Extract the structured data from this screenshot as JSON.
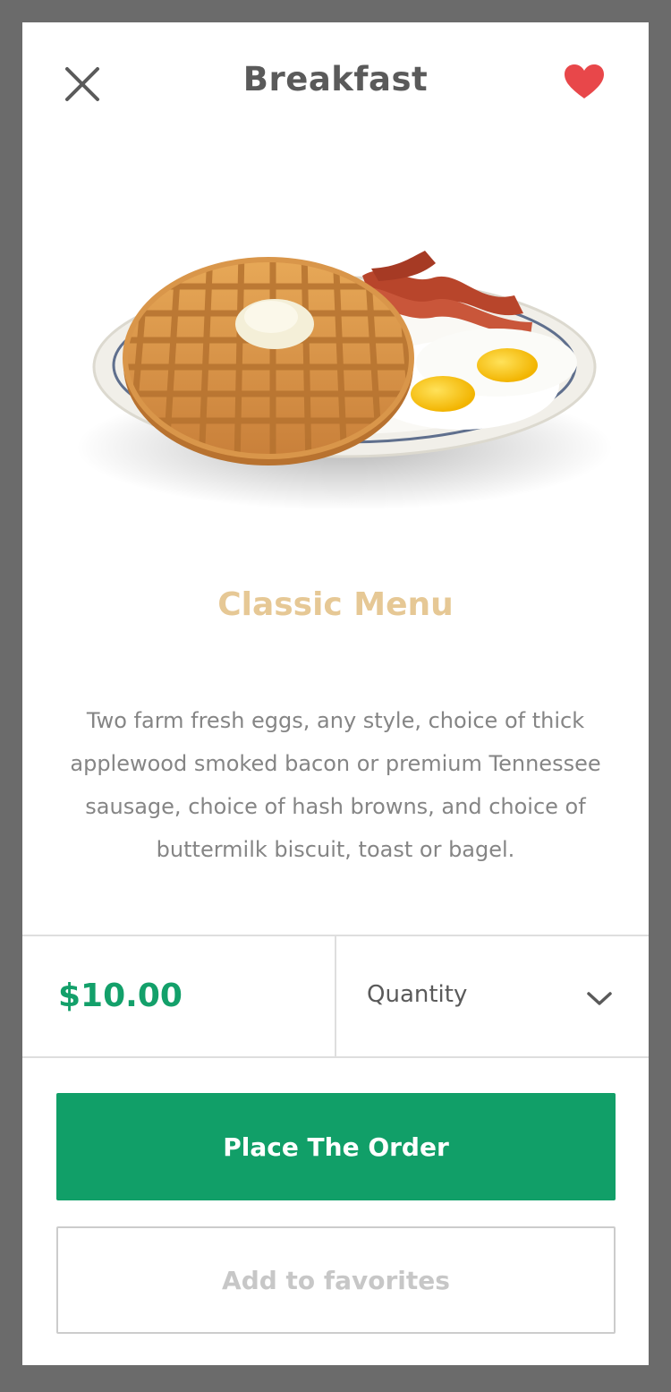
{
  "header": {
    "title": "Breakfast",
    "close_icon": "close-icon",
    "favorite_icon": "heart-icon",
    "favorite_color": "#e8474a"
  },
  "product": {
    "image": "waffle-breakfast-plate",
    "title": "Classic Menu",
    "description": "Two farm fresh eggs, any style, choice of thick applewood smoked bacon or premium Tennessee sausage, choice of hash browns, and choice of buttermilk biscuit, toast or bagel."
  },
  "purchase": {
    "price": "$10.00",
    "quantity_label": "Quantity",
    "quantity_icon": "chevron-down-icon"
  },
  "actions": {
    "order_label": "Place The Order",
    "favorites_label": "Add to favorites"
  },
  "colors": {
    "accent": "#119f68",
    "title_gold": "#e6c895",
    "background": "#6b6b6b"
  }
}
